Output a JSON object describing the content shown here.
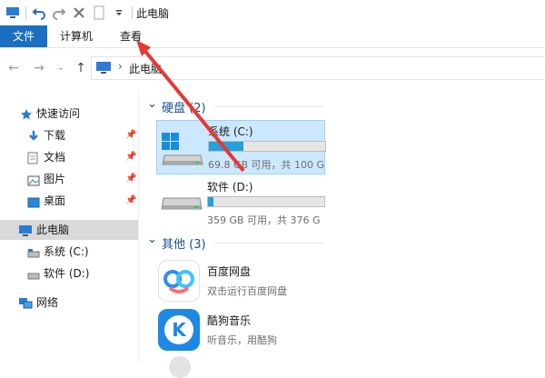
{
  "window": {
    "title": "此电脑",
    "qat_icons": [
      "computer-icon",
      "undo-icon",
      "redo-icon",
      "delete-icon",
      "new-file-icon",
      "customize-arrow-icon"
    ]
  },
  "ribbon": {
    "tabs": [
      {
        "label": "文件",
        "active": true
      },
      {
        "label": "计算机"
      },
      {
        "label": "查看"
      }
    ],
    "accent": "#1a6fc2"
  },
  "address_bar": {
    "path_separator": "›",
    "path": "此电脑"
  },
  "sidebar": {
    "items": [
      {
        "label": "快速访问",
        "icon": "star-icon"
      },
      {
        "label": "下载",
        "icon": "download-icon",
        "pinned": true
      },
      {
        "label": "文档",
        "icon": "document-icon",
        "pinned": true
      },
      {
        "label": "图片",
        "icon": "pictures-icon",
        "pinned": true
      },
      {
        "label": "桌面",
        "icon": "desktop-icon",
        "pinned": true
      },
      {
        "label": "此电脑",
        "icon": "computer-icon",
        "selected": true
      },
      {
        "label": "系统 (C:)",
        "icon": "drive-icon"
      },
      {
        "label": "软件 (D:)",
        "icon": "drive-icon"
      },
      {
        "label": "网络",
        "icon": "network-icon"
      }
    ],
    "pin_glyph": "📌"
  },
  "main": {
    "groups": [
      {
        "title": "硬盘 (2)",
        "collapse_glyph": "⌄"
      },
      {
        "title": "其他 (3)",
        "collapse_glyph": "⌄"
      }
    ],
    "drives": [
      {
        "name": "系统 (C:)",
        "info": "69.8 GB 可用，共 100 G",
        "used_fraction": 0.3
      },
      {
        "name": "软件 (D:)",
        "info": "359 GB 可用，共 376 G",
        "used_fraction": 0.05
      }
    ],
    "apps": [
      {
        "name": "百度网盘",
        "desc": "双击运行百度网盘",
        "icon": "baidu-netdisk-icon"
      },
      {
        "name": "酷狗音乐",
        "desc": "听音乐，用酷狗",
        "icon": "kugou-music-icon",
        "icon_glyph": "K"
      }
    ]
  },
  "annotation": {
    "color": "#e53935"
  },
  "colors": {
    "selection": "#d9d9d9",
    "drive_fill": "#26a0da",
    "group_header": "#1a4e8a"
  }
}
